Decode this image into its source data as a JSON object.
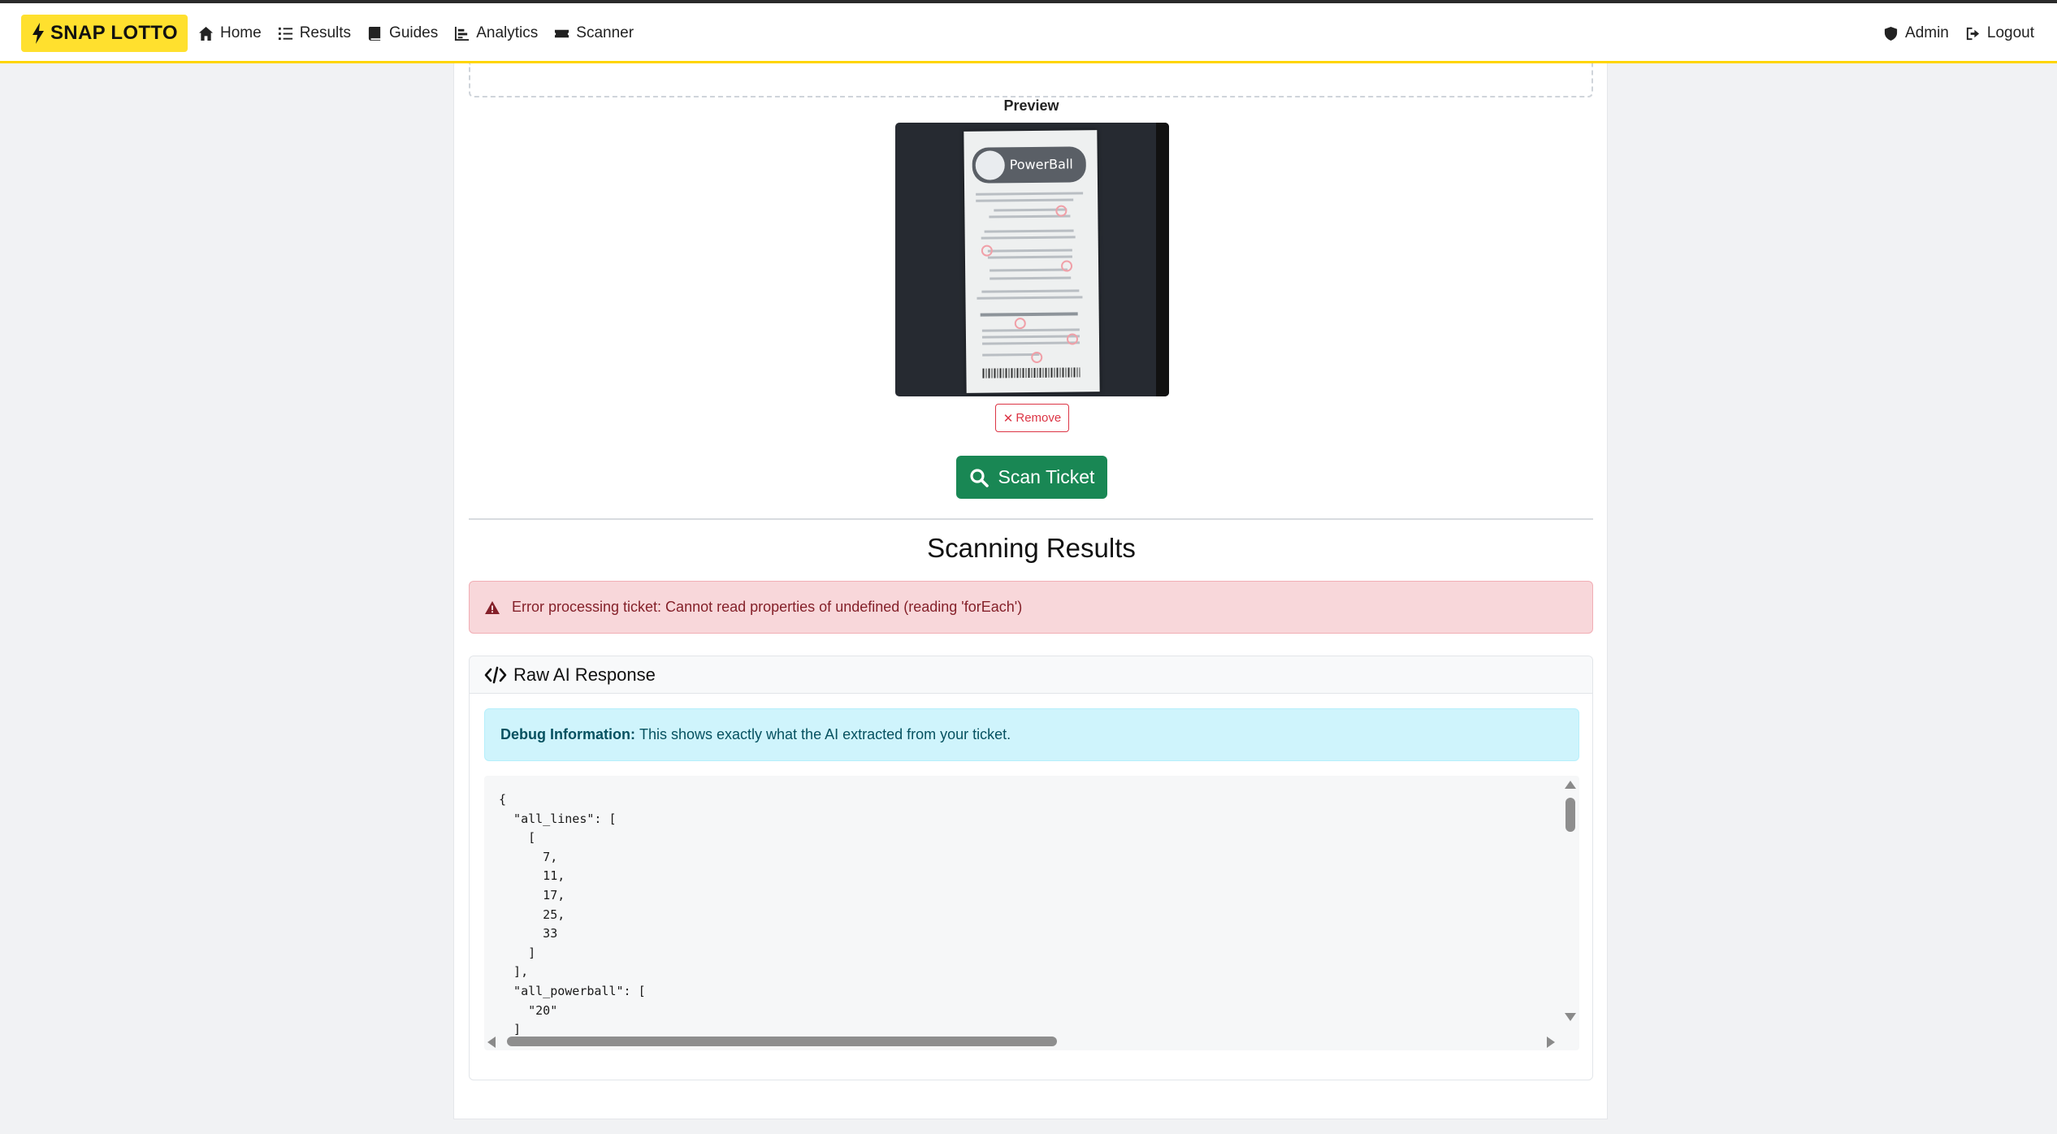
{
  "navbar": {
    "brand": "SNAP LOTTO",
    "items": [
      {
        "label": "Home",
        "icon": "home-icon"
      },
      {
        "label": "Results",
        "icon": "list-ol-icon"
      },
      {
        "label": "Guides",
        "icon": "book-icon"
      },
      {
        "label": "Analytics",
        "icon": "chart-bar-icon"
      },
      {
        "label": "Scanner",
        "icon": "ticket-icon"
      }
    ],
    "right": [
      {
        "label": "Admin",
        "icon": "shield-icon"
      },
      {
        "label": "Logout",
        "icon": "sign-out-icon"
      }
    ]
  },
  "preview": {
    "label": "Preview",
    "ticket_logo": "PowerBall",
    "remove_label": "Remove"
  },
  "scan": {
    "button_label": "Scan Ticket"
  },
  "results": {
    "title": "Scanning Results",
    "error": "Error processing ticket: Cannot read properties of undefined (reading 'forEach')"
  },
  "debug": {
    "header": "Raw AI Response",
    "info_bold": "Debug Information:",
    "info_text": "This shows exactly what the AI extracted from your ticket.",
    "raw_json": "{\n  \"all_lines\": [\n    [\n      7,\n      11,\n      17,\n      25,\n      33\n    ]\n  ],\n  \"all_powerball\": [\n    \"20\"\n  ]"
  },
  "colors": {
    "brand_yellow": "#ffe02e",
    "success": "#198754",
    "danger": "#dc3545",
    "info_bg": "#cff4fc"
  }
}
